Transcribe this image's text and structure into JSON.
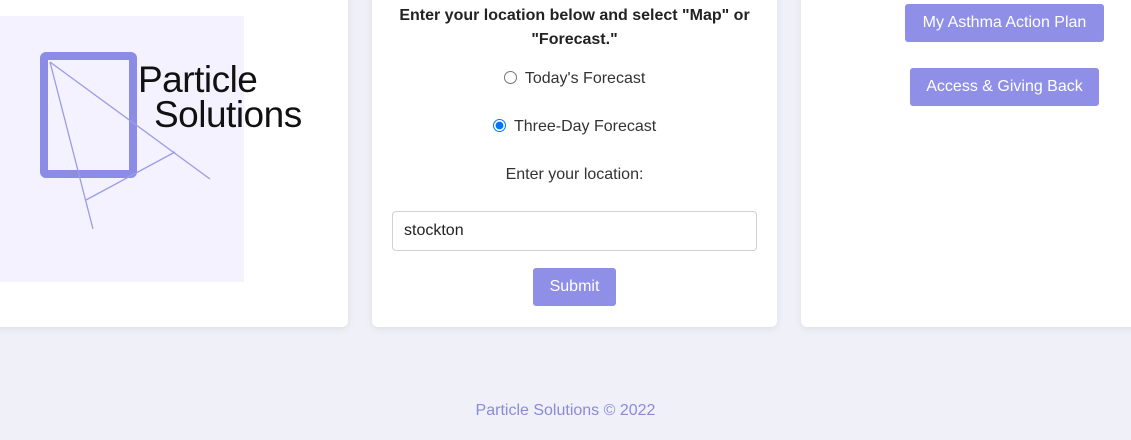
{
  "logo": {
    "line1": "Particle",
    "line2": "Solutions"
  },
  "forecast_form": {
    "prompt": "Enter your location below and select \"Map\" or \"Forecast.\"",
    "options": [
      {
        "label": "Today's Forecast",
        "checked": false
      },
      {
        "label": "Three-Day Forecast",
        "checked": true
      }
    ],
    "location_label": "Enter your location:",
    "location_value": "stockton",
    "submit_label": "Submit"
  },
  "right_panel": {
    "asthma_plan_label": "My Asthma Action Plan",
    "access_label": "Access & Giving Back"
  },
  "footer": {
    "text": "Particle Solutions © 2022"
  },
  "colors": {
    "accent": "#8f8fe8",
    "page_bg": "#f0f0f8",
    "logo_bg": "#f3f2fe",
    "logo_stroke": "#8c8ce6"
  }
}
